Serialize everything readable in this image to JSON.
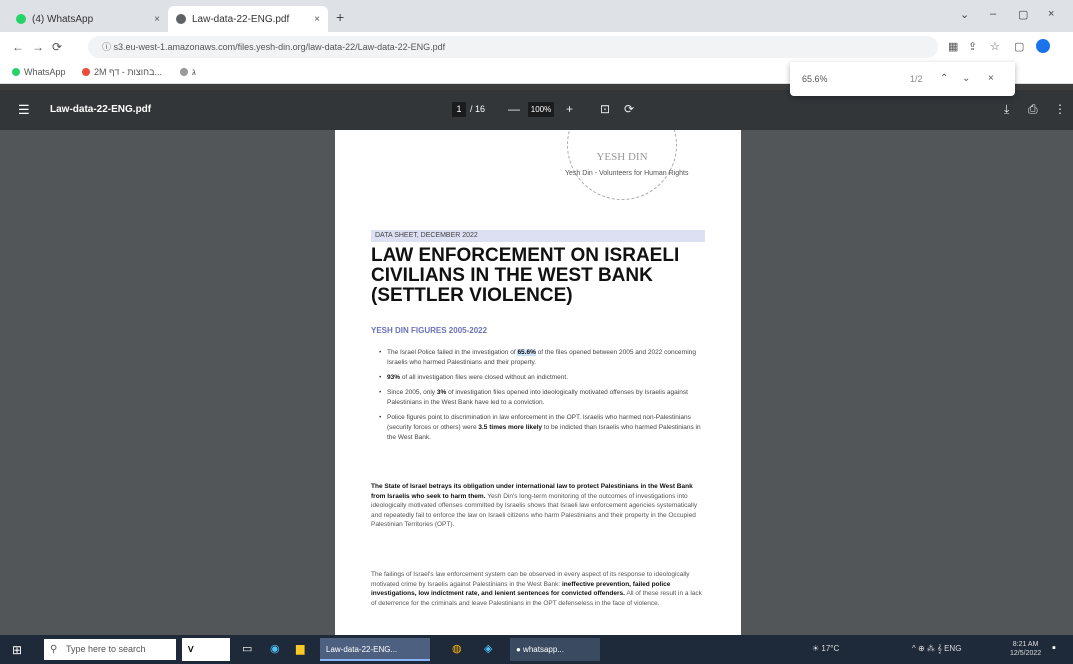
{
  "browser": {
    "tabs": [
      {
        "label": "(4) WhatsApp",
        "close": "×",
        "color": "#25d366"
      },
      {
        "label": "Law-data-22-ENG.pdf",
        "close": "×",
        "color": "#5f6368"
      }
    ],
    "new_tab": "+",
    "window_controls": [
      "⌄",
      "–",
      "▢",
      "×"
    ],
    "nav": [
      "←",
      "→",
      "⟳",
      "ⓘ"
    ],
    "url": "s3.eu-west-1.amazonaws.com/files.yesh-din.org/law-data-22/Law-data-22-ENG.pdf",
    "toolbar_icons": [
      "▦",
      "⇪",
      "☆",
      "▢"
    ],
    "bookmarks": [
      {
        "label": "WhatsApp",
        "color": "#25d366"
      },
      {
        "label": "2M בחוצות - דף...",
        "color": "#e74c3c"
      },
      {
        "label": "ג",
        "color": "#999999"
      }
    ]
  },
  "findbar": {
    "query": "65.6%",
    "count": "1/2",
    "prev": "⌃",
    "next": "⌄",
    "close": "×"
  },
  "pdf_toolbar": {
    "menu": "☰",
    "filename": "Law-data-22-ENG.pdf",
    "page_current": "1",
    "page_total": "/ 16",
    "zoom_minus": "—",
    "zoom": "100%",
    "zoom_plus": "+",
    "fit": "⊡",
    "rotate": "⟳",
    "download": "⤓",
    "print": "⎙",
    "more": "⋮"
  },
  "document": {
    "stamp_text": "YESH DIN",
    "org_line": "Yesh Din - Volunteers for Human Rights",
    "datasheet_label": "DATA SHEET, DECEMBER 2022",
    "title": "LAW ENFORCEMENT ON ISRAELI CIVILIANS IN THE WEST BANK (SETTLER VIOLENCE)",
    "subtitle": "YESH DIN FIGURES 2005-2022",
    "bullets": [
      {
        "pre": "The Israel Police failed in the investigation of ",
        "bold": "65.6%",
        "post": " of the files opened between 2005 and 2022 concerning Israelis who harmed Palestinians and their property."
      },
      {
        "pre": "",
        "bold": "93%",
        "post": " of all investigation files were closed without an indictment."
      },
      {
        "pre": "Since 2005, only ",
        "bold": "3%",
        "post": " of investigation files opened into ideologically motivated offenses by Israelis against Palestinians in the West Bank have led to a conviction."
      },
      {
        "pre": "Police figures point to discrimination in law enforcement in the OPT. Israelis who harmed non-Palestinians (security forces or others) were ",
        "bold": "3.5 times more likely",
        "post": " to be indicted than Israelis who harmed Palestinians in the West Bank."
      }
    ],
    "para1_bold": "The State of Israel betrays its obligation under international law to protect Palestinians in the West Bank from Israelis who seek to harm them.",
    "para1_rest": " Yesh Din's long-term monitoring of the outcomes of investigations into ideologically motivated offenses committed by Israelis shows that Israeli law enforcement agencies systematically and repeatedly fail to enforce the law on Israeli citizens who harm Palestinians and their property in the Occupied Palestinian Territories (OPT).",
    "para2_pre": "The failings of Israel's law enforcement system can be observed in every aspect of its response to ideologically motivated crime by Israelis against Palestinians in the West Bank: ",
    "para2_bold": "ineffective prevention, failed police investigations, low indictment rate, and lenient sentences for convicted offenders.",
    "para2_post": " All of these result in a lack of deterrence for the criminals and leave Palestinians in the OPT defenseless in the face of violence."
  },
  "taskbar": {
    "start": "⊞",
    "search_icon": "⚲",
    "search_placeholder": "Type here to search",
    "apps": [
      {
        "label": "ᐯ",
        "active": false
      },
      {
        "label": "Law-data-22-ENG...",
        "active": true
      },
      {
        "label": "",
        "active": false
      },
      {
        "label": "",
        "active": false
      },
      {
        "label": "● whatsapp...",
        "active": false
      }
    ],
    "weather": "☀ 17°C",
    "tray_text": "^ ⊕ ⁂ 𝄞 ENG",
    "time": "8:21 AM",
    "date": "12/5/2022"
  }
}
